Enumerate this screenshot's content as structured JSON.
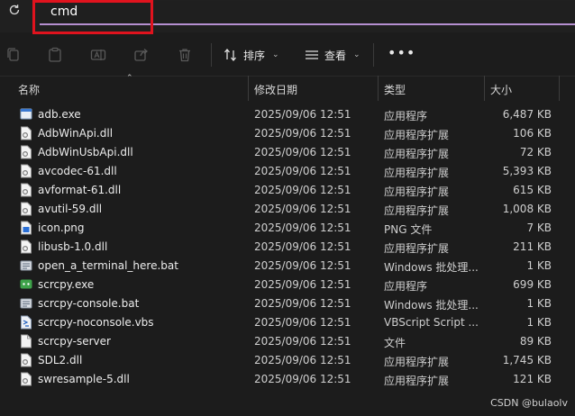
{
  "address": {
    "value": "cmd"
  },
  "toolbar": {
    "sort_label": "排序",
    "view_label": "查看",
    "more_label": "•••"
  },
  "columns": {
    "name": "名称",
    "date": "修改日期",
    "type": "类型",
    "size": "大小"
  },
  "files": [
    {
      "name": "adb.exe",
      "date": "2025/09/06 12:51",
      "type": "应用程序",
      "size": "6,487 KB",
      "icon": "exe-icon"
    },
    {
      "name": "AdbWinApi.dll",
      "date": "2025/09/06 12:51",
      "type": "应用程序扩展",
      "size": "106 KB",
      "icon": "dll-icon"
    },
    {
      "name": "AdbWinUsbApi.dll",
      "date": "2025/09/06 12:51",
      "type": "应用程序扩展",
      "size": "72 KB",
      "icon": "dll-icon"
    },
    {
      "name": "avcodec-61.dll",
      "date": "2025/09/06 12:51",
      "type": "应用程序扩展",
      "size": "5,393 KB",
      "icon": "dll-icon"
    },
    {
      "name": "avformat-61.dll",
      "date": "2025/09/06 12:51",
      "type": "应用程序扩展",
      "size": "615 KB",
      "icon": "dll-icon"
    },
    {
      "name": "avutil-59.dll",
      "date": "2025/09/06 12:51",
      "type": "应用程序扩展",
      "size": "1,008 KB",
      "icon": "dll-icon"
    },
    {
      "name": "icon.png",
      "date": "2025/09/06 12:51",
      "type": "PNG 文件",
      "size": "7 KB",
      "icon": "png-icon"
    },
    {
      "name": "libusb-1.0.dll",
      "date": "2025/09/06 12:51",
      "type": "应用程序扩展",
      "size": "211 KB",
      "icon": "dll-icon"
    },
    {
      "name": "open_a_terminal_here.bat",
      "date": "2025/09/06 12:51",
      "type": "Windows 批处理...",
      "size": "1 KB",
      "icon": "bat-icon"
    },
    {
      "name": "scrcpy.exe",
      "date": "2025/09/06 12:51",
      "type": "应用程序",
      "size": "699 KB",
      "icon": "scrcpy-icon"
    },
    {
      "name": "scrcpy-console.bat",
      "date": "2025/09/06 12:51",
      "type": "Windows 批处理...",
      "size": "1 KB",
      "icon": "bat-icon"
    },
    {
      "name": "scrcpy-noconsole.vbs",
      "date": "2025/09/06 12:51",
      "type": "VBScript Script ...",
      "size": "1 KB",
      "icon": "vbs-icon"
    },
    {
      "name": "scrcpy-server",
      "date": "2025/09/06 12:51",
      "type": "文件",
      "size": "89 KB",
      "icon": "file-icon"
    },
    {
      "name": "SDL2.dll",
      "date": "2025/09/06 12:51",
      "type": "应用程序扩展",
      "size": "1,745 KB",
      "icon": "dll-icon"
    },
    {
      "name": "swresample-5.dll",
      "date": "2025/09/06 12:51",
      "type": "应用程序扩展",
      "size": "121 KB",
      "icon": "dll-icon"
    }
  ],
  "watermark": "CSDN @bulaolv"
}
